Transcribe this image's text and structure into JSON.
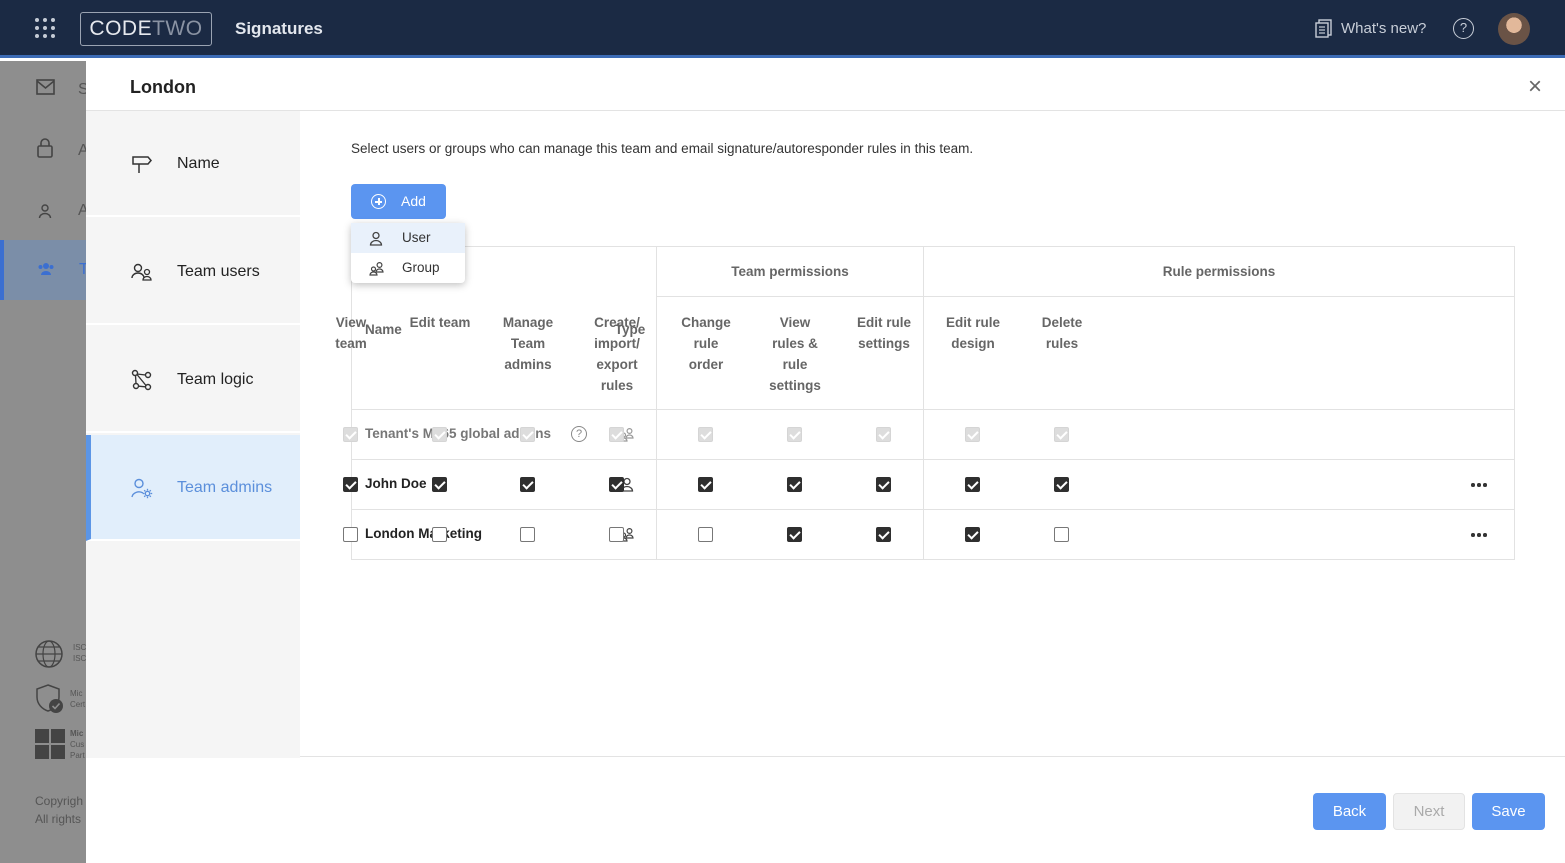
{
  "topbar": {
    "logo_code": "CODE",
    "logo_two": "TWO",
    "app_title": "Signatures",
    "whats_new": "What's new?",
    "help": "?"
  },
  "bg_sidebar": {
    "labels": [
      "S",
      "A",
      "A",
      "T"
    ],
    "badges": [
      [
        "ISC",
        "ISC"
      ],
      [
        "Mic",
        "Cert"
      ],
      [
        "Mic",
        "Cus",
        "Part"
      ]
    ],
    "copyright": [
      "Copyrigh",
      "All rights"
    ]
  },
  "panel": {
    "title": "London",
    "close": "×"
  },
  "nav": {
    "items": [
      {
        "label": "Name",
        "icon": "signpost-icon"
      },
      {
        "label": "Team users",
        "icon": "team-users-icon"
      },
      {
        "label": "Team logic",
        "icon": "logic-icon"
      },
      {
        "label": "Team admins",
        "icon": "admin-gear-icon"
      }
    ]
  },
  "content": {
    "description": "Select users or groups who can manage this team and email signature/autoresponder rules in this team.",
    "add_label": "Add",
    "add_menu": [
      {
        "label": "User",
        "icon": "user-icon"
      },
      {
        "label": "Group",
        "icon": "group-icon"
      }
    ]
  },
  "table": {
    "group_headers": {
      "team": "Team permissions",
      "rule": "Rule permissions"
    },
    "col_name": "Name",
    "col_type": "Type",
    "perm_headers": [
      [
        "View",
        "team"
      ],
      [
        "Edit team"
      ],
      [
        "Manage",
        "Team",
        "admins"
      ],
      [
        "Create/",
        "import/",
        "export",
        "rules"
      ],
      [
        "Change",
        "rule",
        "order"
      ],
      [
        "View",
        "rules &",
        "rule",
        "settings"
      ],
      [
        "Edit rule",
        "settings"
      ],
      [
        "Edit rule",
        "design"
      ],
      [
        "Delete",
        "rules"
      ]
    ],
    "rows": [
      {
        "name": "Tenant's M365 global admins",
        "type": "group",
        "help": "?",
        "disabled": true,
        "perms": [
          true,
          true,
          true,
          true,
          true,
          true,
          true,
          true,
          true
        ]
      },
      {
        "name": "John Doe",
        "type": "user",
        "disabled": false,
        "perms": [
          true,
          true,
          true,
          true,
          true,
          true,
          true,
          true,
          true
        ]
      },
      {
        "name": "London Marketing",
        "type": "group",
        "disabled": false,
        "perms": [
          false,
          false,
          false,
          false,
          false,
          true,
          true,
          true,
          false
        ]
      }
    ]
  },
  "footer": {
    "back": "Back",
    "next": "Next",
    "save": "Save"
  },
  "colors": {
    "topbar": "#1b2a44",
    "accent": "#5b95f0",
    "nav_active_bg": "#e1eefb",
    "nav_active_text": "#5b8fdb"
  }
}
